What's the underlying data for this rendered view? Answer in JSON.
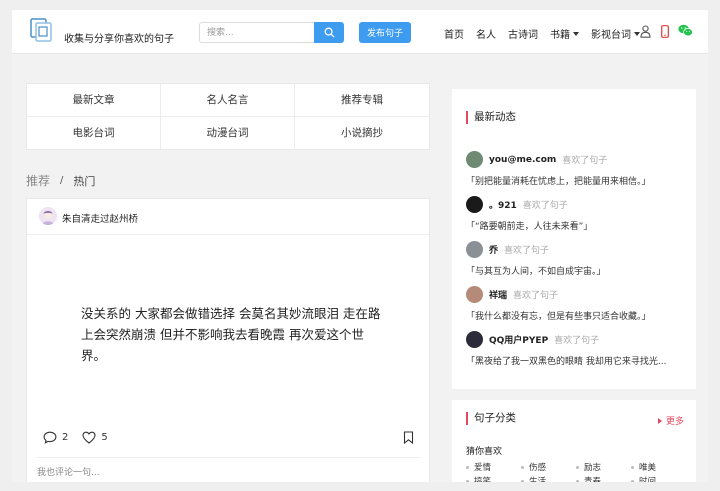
{
  "header": {
    "slogan": "收集与分享你喜欢的句子",
    "search_placeholder": "搜索...",
    "publish_label": "发布句子",
    "nav": [
      "首页",
      "名人",
      "古诗词",
      "书籍",
      "影视台词"
    ]
  },
  "categories": [
    "最新文章",
    "名人名言",
    "推荐专辑",
    "电影台词",
    "动漫台词",
    "小说摘抄"
  ],
  "breadcrumb": {
    "root": "推荐",
    "sep": "/",
    "current": "热门"
  },
  "post": {
    "author": "朱自清走过赵州桥",
    "text": "没关系的 大家都会做错选择 会莫名其妙流眼泪 走在路上会突然崩溃 但并不影响我去看晚霞 再次爱这个世界。",
    "comments": "2",
    "likes": "5",
    "comment_placeholder": "我也评论一句..."
  },
  "sidebar": {
    "activity_title": "最新动态",
    "activities": [
      {
        "user": "you@me.com",
        "verb": "喜欢了句子",
        "text": "「别把能量消耗在忧虑上，把能量用来相信。」",
        "avatar_color": "#6f8a72"
      },
      {
        "user": "。921",
        "verb": "喜欢了句子",
        "text": "「“路要朝前走，人往未来看”」",
        "avatar_color": "#1a1a1a"
      },
      {
        "user": "乔",
        "verb": "喜欢了句子",
        "text": "「与其互为人间，不如自成宇宙。」",
        "avatar_color": "#8a9095"
      },
      {
        "user": "祥瑞",
        "verb": "喜欢了句子",
        "text": "「我什么都没有忘，但是有些事只适合收藏。」",
        "avatar_color": "#b58a78"
      },
      {
        "user": "QQ用户PYEP",
        "verb": "喜欢了句子",
        "text": "「黑夜给了我一双黑色的眼睛 我却用它来寻找光...",
        "avatar_color": "#2b2b3a"
      }
    ],
    "category_title": "句子分类",
    "more_label": "更多",
    "guess_label": "猜你喜欢",
    "tags": [
      "爱情",
      "伤感",
      "励志",
      "唯美",
      "搞笑",
      "生活",
      "青春",
      "时间"
    ]
  },
  "colors": {
    "accent": "#3d9bf0",
    "highlight": "#e8465f",
    "wechat": "#23c14d"
  }
}
